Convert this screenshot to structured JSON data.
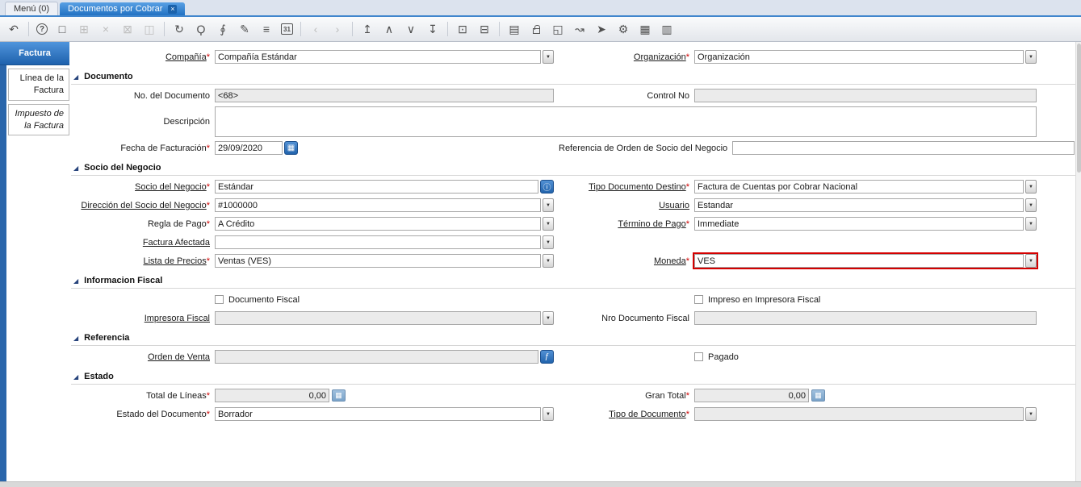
{
  "colors": {
    "active_tab": "#2a75c7",
    "sidebar_strip": "#2a66ab",
    "action_button": "#2e6fb8",
    "highlight_border": "#d40000",
    "required_marker": "#cf0000"
  },
  "window_tabs": {
    "menu": "Menú (0)",
    "doc": "Documentos por Cobrar",
    "close": "×"
  },
  "toolbar": {
    "icons": [
      {
        "name": "undo-icon",
        "glyph": "↶"
      },
      {
        "name": "help-icon",
        "glyph": "?"
      },
      {
        "name": "new-record-icon",
        "glyph": "□"
      },
      {
        "name": "copy-record-icon",
        "glyph": "⊞"
      },
      {
        "name": "delete-record-icon",
        "glyph": "×"
      },
      {
        "name": "delete-selection-icon",
        "glyph": "⊠"
      },
      {
        "name": "save-icon",
        "glyph": "◫"
      },
      {
        "name": "refresh-icon",
        "glyph": "↻"
      },
      {
        "name": "find-icon",
        "glyph": "Ϙ"
      },
      {
        "name": "attachment-icon",
        "glyph": "∮"
      },
      {
        "name": "chat-icon",
        "glyph": "✎"
      },
      {
        "name": "grid-toggle-icon",
        "glyph": "≡"
      },
      {
        "name": "calendar-icon",
        "glyph": "31"
      },
      {
        "name": "previous-tab-icon",
        "glyph": "‹"
      },
      {
        "name": "next-tab-icon",
        "glyph": "›"
      },
      {
        "name": "first-record-icon",
        "glyph": "↥"
      },
      {
        "name": "previous-record-icon",
        "glyph": "∧"
      },
      {
        "name": "next-record-icon",
        "glyph": "∨"
      },
      {
        "name": "last-record-icon",
        "glyph": "↧"
      },
      {
        "name": "parent-record-icon",
        "glyph": "⊡"
      },
      {
        "name": "detail-record-icon",
        "glyph": "⊟"
      },
      {
        "name": "print-icon",
        "glyph": "▤"
      },
      {
        "name": "lock-icon"
      },
      {
        "name": "zoom-across-icon",
        "glyph": "◱"
      },
      {
        "name": "workflow-icon",
        "glyph": "↝"
      },
      {
        "name": "send-mail-icon",
        "glyph": "➤"
      },
      {
        "name": "preferences-icon",
        "glyph": "⚙"
      },
      {
        "name": "product-info-icon",
        "glyph": "▦"
      },
      {
        "name": "report-icon",
        "glyph": "▥"
      }
    ]
  },
  "sidebar": {
    "tabs": [
      {
        "label": "Factura"
      },
      {
        "label": "Línea de la Factura"
      },
      {
        "label": "Impuesto de la Factura"
      }
    ]
  },
  "sections": {
    "documento": "Documento",
    "socio": "Socio del Negocio",
    "fiscal": "Informacion Fiscal",
    "referencia": "Referencia",
    "estado": "Estado"
  },
  "fields": {
    "compania": {
      "label": "Compañía",
      "req": "*",
      "value": "Compañía Estándar"
    },
    "organizacion": {
      "label": "Organización",
      "req": "*",
      "value": "Organización"
    },
    "no_documento": {
      "label": "No. del Documento",
      "value": "<68>"
    },
    "control_no": {
      "label": "Control No",
      "value": ""
    },
    "descripcion": {
      "label": "Descripción",
      "value": ""
    },
    "fecha_facturacion": {
      "label": "Fecha de Facturación",
      "req": "*",
      "value": "29/09/2020"
    },
    "referencia_orden": {
      "label": "Referencia de Orden de Socio del Negocio",
      "value": ""
    },
    "socio_negocio": {
      "label": "Socio del Negocio",
      "req": "*",
      "value": "Estándar"
    },
    "tipo_doc_destino": {
      "label": "Tipo Documento Destino",
      "req": "*",
      "value": "Factura de Cuentas por Cobrar Nacional"
    },
    "direccion_socio": {
      "label": "Dirección del Socio del Negocio",
      "req": "*",
      "value": "#1000000"
    },
    "usuario": {
      "label": "Usuario",
      "value": "Estandar"
    },
    "regla_pago": {
      "label": "Regla de Pago",
      "req": "*",
      "value": "A Crédito"
    },
    "termino_pago": {
      "label": "Término de Pago",
      "req": "*",
      "value": "Immediate"
    },
    "factura_afectada": {
      "label": "Factura Afectada",
      "value": ""
    },
    "lista_precios": {
      "label": "Lista de Precios",
      "req": "*",
      "value": "Ventas (VES)"
    },
    "moneda": {
      "label": "Moneda",
      "req": "*",
      "value": "VES"
    },
    "documento_fiscal": {
      "label": "Documento Fiscal"
    },
    "impreso_fiscal": {
      "label": "Impreso en Impresora Fiscal"
    },
    "impresora_fiscal": {
      "label": "Impresora Fiscal",
      "value": ""
    },
    "nro_doc_fiscal": {
      "label": "Nro Documento Fiscal",
      "value": ""
    },
    "orden_venta": {
      "label": "Orden de Venta",
      "value": ""
    },
    "pagado": {
      "label": "Pagado"
    },
    "total_lineas": {
      "label": "Total de Líneas",
      "req": "*",
      "value": "0,00"
    },
    "gran_total": {
      "label": "Gran Total",
      "req": "*",
      "value": "0,00"
    },
    "estado_documento": {
      "label": "Estado del Documento",
      "req": "*",
      "value": "Borrador"
    },
    "tipo_documento": {
      "label": "Tipo de Documento",
      "req": "*",
      "value": ""
    }
  },
  "ui": {
    "combo_arrow": "▼",
    "section_arrow": "◢",
    "calendar_glyph": "▦",
    "calc_glyph": "▦",
    "bp_button_glyph": "ⓘ",
    "order_button_glyph": "ƒ"
  }
}
